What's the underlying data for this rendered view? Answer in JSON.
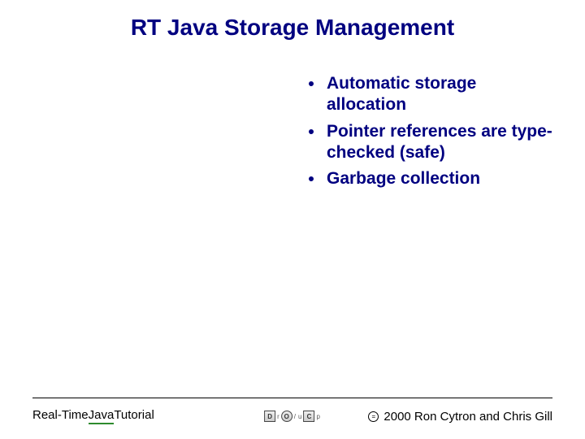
{
  "title": "RT Java Storage Management",
  "bullets": [
    "Automatic storage allocation",
    "Pointer references are type-checked (safe)",
    "Garbage collection"
  ],
  "footer": {
    "left_plain": "Real-Time ",
    "left_underlined": "Java ",
    "left_tail": "Tutorial",
    "logo_letters": [
      "D",
      "O",
      "C"
    ],
    "logo_small": [
      "r",
      "/",
      "u",
      "p"
    ],
    "copyright_symbol": "=",
    "copyright_text": " 2000 Ron Cytron and Chris Gill"
  }
}
